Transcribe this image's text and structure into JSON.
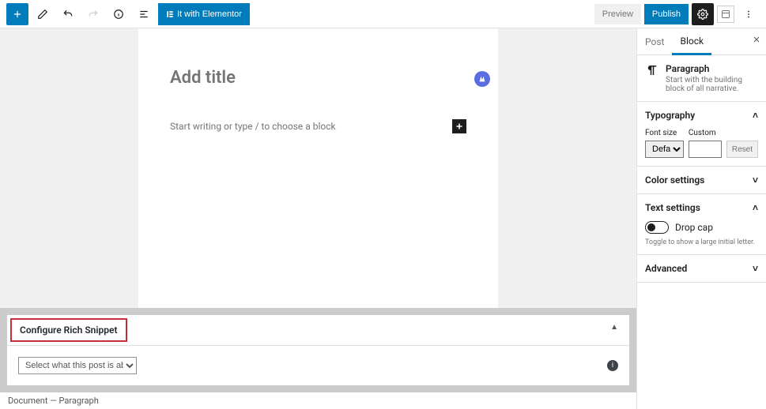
{
  "topbar": {
    "elementor_label": "It with Elementor",
    "preview_label": "Preview",
    "publish_label": "Publish"
  },
  "editor": {
    "title_placeholder": "Add title",
    "paragraph_placeholder": "Start writing or type / to choose a block"
  },
  "sidebar": {
    "tab_post": "Post",
    "tab_block": "Block",
    "block_name": "Paragraph",
    "block_desc": "Start with the building block of all narrative.",
    "typography": {
      "title": "Typography",
      "font_size_label": "Font size",
      "custom_label": "Custom",
      "font_size_value": "Default",
      "reset_label": "Reset"
    },
    "color": {
      "title": "Color settings"
    },
    "text": {
      "title": "Text settings",
      "dropcap_label": "Drop cap",
      "dropcap_help": "Toggle to show a large initial letter."
    },
    "advanced": {
      "title": "Advanced"
    }
  },
  "snippet": {
    "title": "Configure Rich Snippet",
    "select_placeholder": "Select what this post is about"
  },
  "breadcrumb": {
    "doc": "Document",
    "sep": " — ",
    "block": "Paragraph"
  }
}
